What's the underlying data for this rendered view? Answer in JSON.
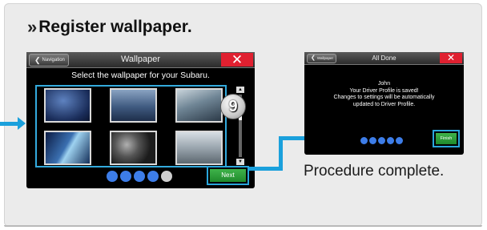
{
  "heading": {
    "marker": "»",
    "text": "Register wallpaper."
  },
  "wallpaper_screen": {
    "back_label": "Navigation",
    "title": "Wallpaper",
    "close_label": "✕",
    "subtitle": "Select the wallpaper for your Subaru.",
    "step_number": "9",
    "next_label": "Next",
    "page_indicator": {
      "total": 5,
      "active": 4
    }
  },
  "done_screen": {
    "back_label": "Wallpaper",
    "title": "All Done",
    "close_label": "✕",
    "message_lines": [
      "John",
      "Your Driver Profile is saved!",
      "Changes to settings will be automatically",
      "updated to Driver Profile."
    ],
    "finish_label": "Finish",
    "page_indicator": {
      "total": 5,
      "active": 5
    }
  },
  "caption": "Procedure complete.",
  "colors": {
    "accent": "#1aa0dc",
    "close_red": "#e02030",
    "action_green": "#2a9e38",
    "indicator_blue": "#3d7de8"
  }
}
